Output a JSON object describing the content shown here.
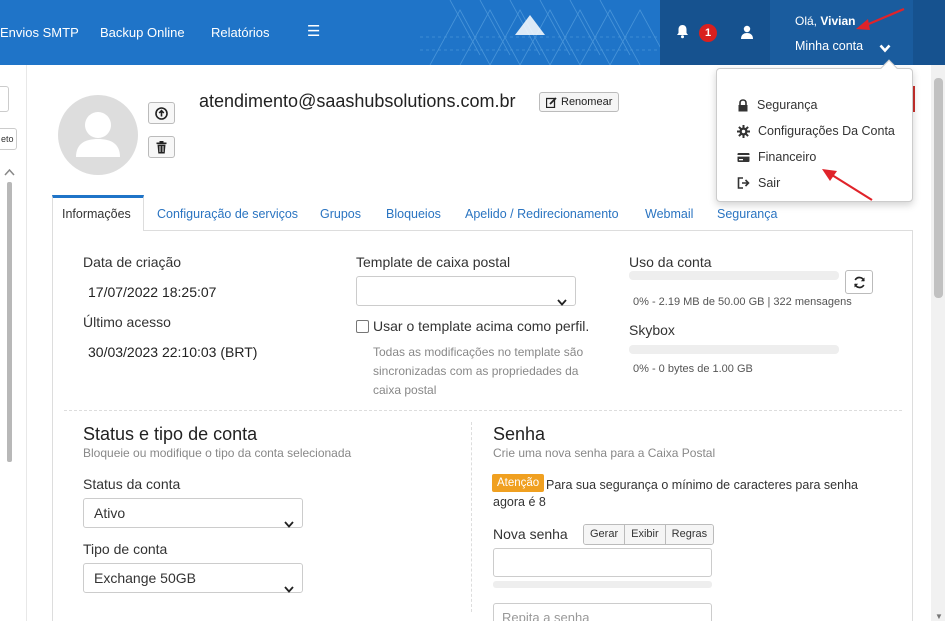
{
  "nav": {
    "items": [
      "Envios SMTP",
      "Backup Online",
      "Relatórios"
    ],
    "notification_count": "1",
    "greeting": "Olá,",
    "user_name": "Vivian",
    "account_label": "Minha conta"
  },
  "dropdown": {
    "items": [
      "Segurança",
      "Configurações Da Conta",
      "Financeiro",
      "Sair"
    ]
  },
  "left_panel": {
    "button_text": "eto"
  },
  "profile": {
    "email": "atendimento@saashubsolutions.com.br",
    "rename_label": "Renomear"
  },
  "tabs": [
    "Informações",
    "Configuração de serviços",
    "Grupos",
    "Bloqueios",
    "Apelido / Redirecionamento",
    "Webmail",
    "Segurança"
  ],
  "info": {
    "created_label": "Data de criação",
    "created_value": "17/07/2022 18:25:07",
    "last_access_label": "Último acesso",
    "last_access_value": "30/03/2023 22:10:03 (BRT)",
    "template_label": "Template de caixa postal",
    "template_value": "",
    "use_template_label": "Usar o template acima como perfil.",
    "template_help": "Todas as modificações no template são sincronizadas com as propriedades da caixa postal",
    "usage_label": "Uso da conta",
    "usage_text": "0% - 2.19 MB de 50.00 GB | 322 mensagens",
    "usage_percent": 0,
    "skybox_label": "Skybox",
    "skybox_text": "0% - 0 bytes de 1.00 GB",
    "skybox_percent": 0
  },
  "status_section": {
    "title": "Status e tipo de conta",
    "subtitle": "Bloqueie ou modifique o tipo da conta selecionada",
    "status_label": "Status da conta",
    "status_value": "Ativo",
    "type_label": "Tipo de conta",
    "type_value": "Exchange 50GB"
  },
  "password_section": {
    "title": "Senha",
    "subtitle": "Crie uma nova senha para a Caixa Postal",
    "warning_badge": "Atenção",
    "warning_text": "Para sua segurança o mínimo de caracteres para senha",
    "warning_text2": "agora é 8",
    "new_password_label": "Nova senha",
    "buttons": [
      "Gerar",
      "Exibir",
      "Regras"
    ],
    "repeat_placeholder": "Repita a senha"
  },
  "colors": {
    "primary": "#1f74c8",
    "dark": "#16528f",
    "warning": "#f0a020",
    "danger": "#d9201f",
    "annotation": "#e0232a"
  }
}
